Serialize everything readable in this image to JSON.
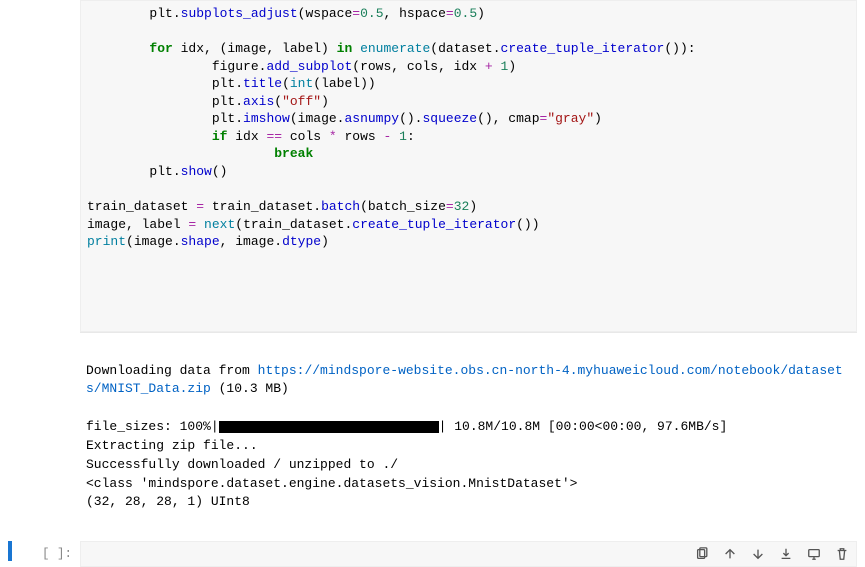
{
  "code": {
    "lines": [
      {
        "indent": 2,
        "tokens": [
          {
            "t": "plt.",
            "c": ""
          },
          {
            "t": "subplots_adjust",
            "c": "k-blue"
          },
          {
            "t": "(wspace",
            "c": ""
          },
          {
            "t": "=",
            "c": "k-op"
          },
          {
            "t": "0.5",
            "c": "k-num"
          },
          {
            "t": ", hspace",
            "c": ""
          },
          {
            "t": "=",
            "c": "k-op"
          },
          {
            "t": "0.5",
            "c": "k-num"
          },
          {
            "t": ")",
            "c": ""
          }
        ]
      },
      {
        "indent": 0,
        "tokens": []
      },
      {
        "indent": 2,
        "tokens": [
          {
            "t": "for",
            "c": "k-green"
          },
          {
            "t": " idx, (image, label) ",
            "c": ""
          },
          {
            "t": "in",
            "c": "k-green"
          },
          {
            "t": " ",
            "c": ""
          },
          {
            "t": "enumerate",
            "c": "k-teal"
          },
          {
            "t": "(dataset.",
            "c": ""
          },
          {
            "t": "create_tuple_iterator",
            "c": "k-blue"
          },
          {
            "t": "()):",
            "c": ""
          }
        ]
      },
      {
        "indent": 4,
        "tokens": [
          {
            "t": "figure.",
            "c": ""
          },
          {
            "t": "add_subplot",
            "c": "k-blue"
          },
          {
            "t": "(rows, cols, idx ",
            "c": ""
          },
          {
            "t": "+",
            "c": "k-op"
          },
          {
            "t": " ",
            "c": ""
          },
          {
            "t": "1",
            "c": "k-num"
          },
          {
            "t": ")",
            "c": ""
          }
        ]
      },
      {
        "indent": 4,
        "tokens": [
          {
            "t": "plt.",
            "c": ""
          },
          {
            "t": "title",
            "c": "k-blue"
          },
          {
            "t": "(",
            "c": ""
          },
          {
            "t": "int",
            "c": "k-teal"
          },
          {
            "t": "(label))",
            "c": ""
          }
        ]
      },
      {
        "indent": 4,
        "tokens": [
          {
            "t": "plt.",
            "c": ""
          },
          {
            "t": "axis",
            "c": "k-blue"
          },
          {
            "t": "(",
            "c": ""
          },
          {
            "t": "\"off\"",
            "c": "k-str"
          },
          {
            "t": ")",
            "c": ""
          }
        ]
      },
      {
        "indent": 4,
        "tokens": [
          {
            "t": "plt.",
            "c": ""
          },
          {
            "t": "imshow",
            "c": "k-blue"
          },
          {
            "t": "(image.",
            "c": ""
          },
          {
            "t": "asnumpy",
            "c": "k-blue"
          },
          {
            "t": "().",
            "c": ""
          },
          {
            "t": "squeeze",
            "c": "k-blue"
          },
          {
            "t": "(), cmap",
            "c": ""
          },
          {
            "t": "=",
            "c": "k-op"
          },
          {
            "t": "\"gray\"",
            "c": "k-str"
          },
          {
            "t": ")",
            "c": ""
          }
        ]
      },
      {
        "indent": 4,
        "tokens": [
          {
            "t": "if",
            "c": "k-green"
          },
          {
            "t": " idx ",
            "c": ""
          },
          {
            "t": "==",
            "c": "k-op"
          },
          {
            "t": " cols ",
            "c": ""
          },
          {
            "t": "*",
            "c": "k-op"
          },
          {
            "t": " rows ",
            "c": ""
          },
          {
            "t": "-",
            "c": "k-op"
          },
          {
            "t": " ",
            "c": ""
          },
          {
            "t": "1",
            "c": "k-num"
          },
          {
            "t": ":",
            "c": ""
          }
        ]
      },
      {
        "indent": 6,
        "tokens": [
          {
            "t": "break",
            "c": "k-green"
          }
        ]
      },
      {
        "indent": 2,
        "tokens": [
          {
            "t": "plt.",
            "c": ""
          },
          {
            "t": "show",
            "c": "k-blue"
          },
          {
            "t": "()",
            "c": ""
          }
        ]
      },
      {
        "indent": 0,
        "tokens": []
      },
      {
        "indent": 0,
        "tokens": [
          {
            "t": "train_dataset ",
            "c": ""
          },
          {
            "t": "=",
            "c": "k-op"
          },
          {
            "t": " train_dataset.",
            "c": ""
          },
          {
            "t": "batch",
            "c": "k-blue"
          },
          {
            "t": "(batch_size",
            "c": ""
          },
          {
            "t": "=",
            "c": "k-op"
          },
          {
            "t": "32",
            "c": "k-num"
          },
          {
            "t": ")",
            "c": ""
          }
        ]
      },
      {
        "indent": 0,
        "tokens": [
          {
            "t": "image, label ",
            "c": ""
          },
          {
            "t": "=",
            "c": "k-op"
          },
          {
            "t": " ",
            "c": ""
          },
          {
            "t": "next",
            "c": "k-teal"
          },
          {
            "t": "(train_dataset.",
            "c": ""
          },
          {
            "t": "create_tuple_iterator",
            "c": "k-blue"
          },
          {
            "t": "())",
            "c": ""
          }
        ]
      },
      {
        "indent": 0,
        "tokens": [
          {
            "t": "print",
            "c": "k-teal"
          },
          {
            "t": "(image.",
            "c": ""
          },
          {
            "t": "shape",
            "c": "k-blue"
          },
          {
            "t": ", image.",
            "c": ""
          },
          {
            "t": "dtype",
            "c": "k-blue"
          },
          {
            "t": ")",
            "c": ""
          }
        ]
      }
    ]
  },
  "output": {
    "download_prefix": "Downloading data from ",
    "download_url": "https://mindspore-website.obs.cn-north-4.myhuaweicloud.com/notebook/datasets/MNIST_Data.zip",
    "download_size": " (10.3 MB)",
    "progress_label": "file_sizes: 100%|",
    "progress_suffix": "| 10.8M/10.8M [00:00<00:00, 97.6MB/s]",
    "extract_line": "Extracting zip file...",
    "success_line": "Successfully downloaded / unzipped to ./",
    "class_line": "<class 'mindspore.dataset.engine.datasets_vision.MnistDataset'>",
    "shape_line": "(32, 28, 28, 1) UInt8"
  },
  "empty_prompt": "[ ]:",
  "toolbar": {
    "copy": "copy-icon",
    "up": "arrow-up-icon",
    "down": "arrow-down-icon",
    "download": "download-icon",
    "monitor": "monitor-icon",
    "delete": "trash-icon"
  }
}
